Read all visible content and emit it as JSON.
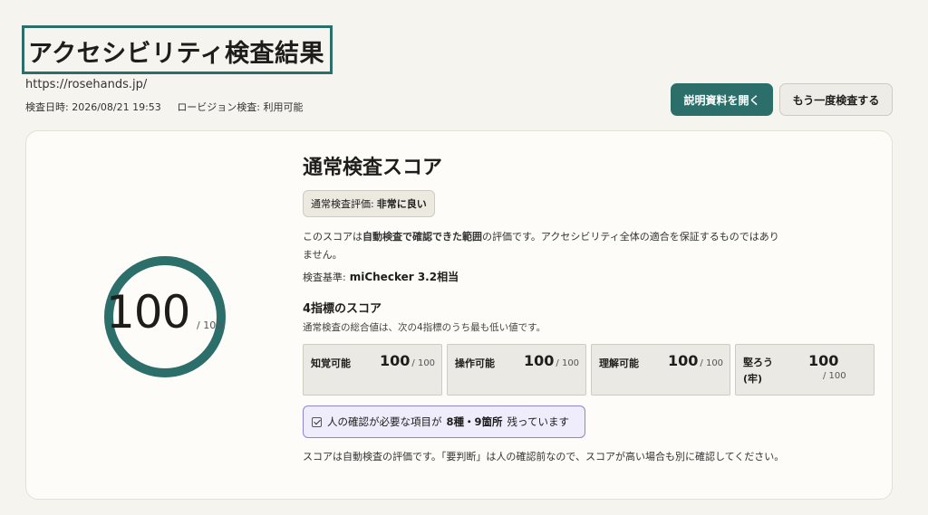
{
  "header": {
    "title": "アクセシビリティ検査結果",
    "url": "https://rosehands.jp/",
    "datetime": "検査日時: 2026/08/21 19:53",
    "roby_check": "ロービジョン検査: 利用可能",
    "open_docs_label": "説明資料を開く",
    "rerun_label": "もう一度検査する"
  },
  "colors": {
    "accent": "#2c6e6a",
    "background": "#f6f4ef",
    "notice_border": "#8f86cf"
  },
  "score": {
    "value": "100",
    "max": "/ 100",
    "fraction": 1.0
  },
  "summary": {
    "title": "通常検査スコア",
    "rating_label": "通常検査評価:",
    "rating_value": "非常に良い",
    "desc_pre": "このスコアは",
    "desc_bold": "自動検査で確認できた範囲",
    "desc_post": "の評価です。アクセシビリティ全体の適合を保証するものではありません。",
    "standard_label": "検査基準:",
    "standard_value": "miChecker 3.2相当"
  },
  "metrics_section": {
    "title": "4指標のスコア",
    "desc": "通常検査の総合値は、次の4指標のうち最も低い値です。",
    "items": [
      {
        "label": "知覚可能",
        "value": "100",
        "max": "/ 100"
      },
      {
        "label": "操作可能",
        "value": "100",
        "max": "/ 100"
      },
      {
        "label": "理解可能",
        "value": "100",
        "max": "/ 100"
      },
      {
        "label": "堅ろう(牢)",
        "value": "100",
        "max": "/ 100"
      }
    ]
  },
  "notice": {
    "icon": "checkbox-checked-icon",
    "pre": "人の確認が必要な項目が",
    "count": "8種・9箇所",
    "post": "残っています"
  },
  "footnote": "スコアは自動検査の評価です。「要判断」は人の確認前なので、スコアが高い場合も別に確認してください。"
}
